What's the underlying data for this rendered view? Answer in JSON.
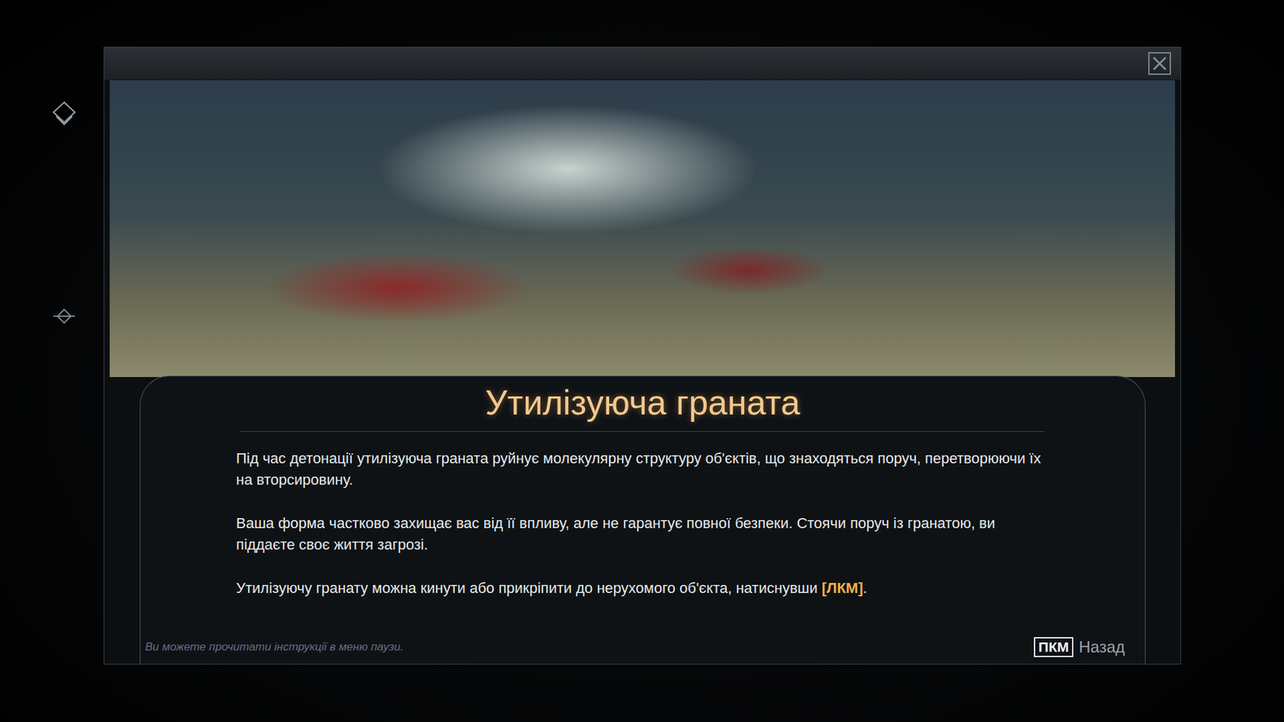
{
  "dialog": {
    "title": "Утилізуюча граната",
    "paragraphs": [
      [
        {
          "text": "Під час детонації утилізуюча граната руйнує молекулярну структуру об'єктів, що знаходяться поруч, перетворюючи їх на вторсировину.",
          "highlight": false
        }
      ],
      [
        {
          "text": "Ваша форма частково захищає вас від її впливу, але не гарантує повної безпеки. Стоячи поруч із гранатою, ви піддаєте своє життя загрозі.",
          "highlight": false
        }
      ],
      [
        {
          "text": "Утилізуючу гранату можна кинути або прикріпити до нерухомого об'єкта, натиснувши ",
          "highlight": false
        },
        {
          "text": "[ЛКМ]",
          "highlight": true
        },
        {
          "text": ".",
          "highlight": false
        }
      ]
    ]
  },
  "footer": {
    "hint": "Ви можете прочитати інструкції в меню паузи.",
    "back_key": "ПКМ",
    "back_label": "Назад"
  }
}
